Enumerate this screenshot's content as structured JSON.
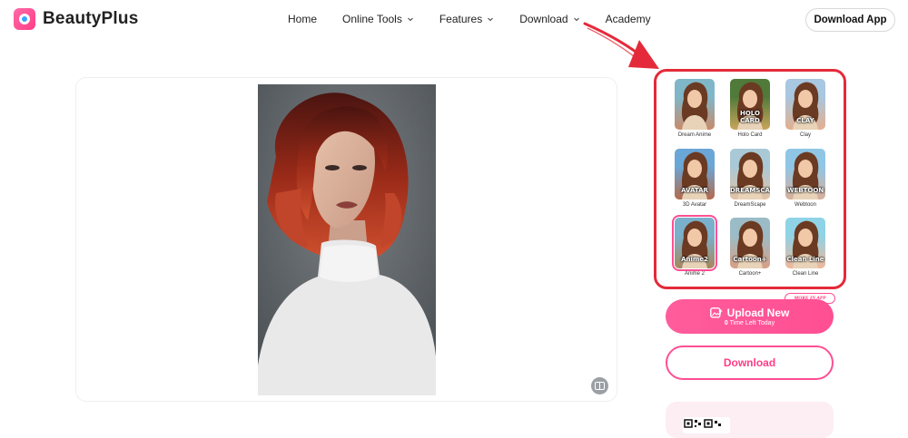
{
  "header": {
    "brand": "BeautyPlus",
    "nav": [
      {
        "label": "Home",
        "dropdown": false
      },
      {
        "label": "Online Tools",
        "dropdown": true
      },
      {
        "label": "Features",
        "dropdown": true
      },
      {
        "label": "Download",
        "dropdown": true
      },
      {
        "label": "Academy",
        "dropdown": false
      }
    ],
    "cta": "Download App"
  },
  "styles": [
    {
      "name": "Dream Anime",
      "overlay": "",
      "bg": [
        "#7fb7c9",
        "#c98b6a"
      ]
    },
    {
      "name": "Holo Card",
      "overlay": "HOLO CARD",
      "bg": [
        "#4f7a3a",
        "#c9a45a"
      ]
    },
    {
      "name": "Clay",
      "overlay": "CLAY",
      "bg": [
        "#a8c7e0",
        "#e3b08f"
      ]
    },
    {
      "name": "3D Avatar",
      "overlay": "AVATAR",
      "bg": [
        "#6aa6d6",
        "#b56a4a"
      ]
    },
    {
      "name": "DreamScape",
      "overlay": "DREAMSCAPE",
      "bg": [
        "#a9c9d6",
        "#e4c2a4"
      ]
    },
    {
      "name": "Webtoon",
      "overlay": "WEBTOON",
      "bg": [
        "#8fc6e6",
        "#d9b09a"
      ]
    },
    {
      "name": "Anime 2",
      "overlay": "Anime2",
      "bg": [
        "#7ab0cc",
        "#a8875c"
      ],
      "selected": true
    },
    {
      "name": "Cartoon+",
      "overlay": "Cartoon+",
      "bg": [
        "#9bbcc7",
        "#d89f84"
      ]
    },
    {
      "name": "Clean Line",
      "overlay": "Clean Line",
      "bg": [
        "#8fd3e6",
        "#f0b89a"
      ]
    }
  ],
  "more_tag": "MORE IN APP",
  "upload": {
    "label": "Upload New",
    "count": "0",
    "sub": "Time Left Today"
  },
  "download_label": "Download",
  "colors": {
    "accent": "#ff4f93",
    "highlight": "#e42a3a"
  },
  "icons": {
    "compare": "compare-icon",
    "upload": "upload-image-icon",
    "logo": "beautyplus-logo-icon"
  }
}
